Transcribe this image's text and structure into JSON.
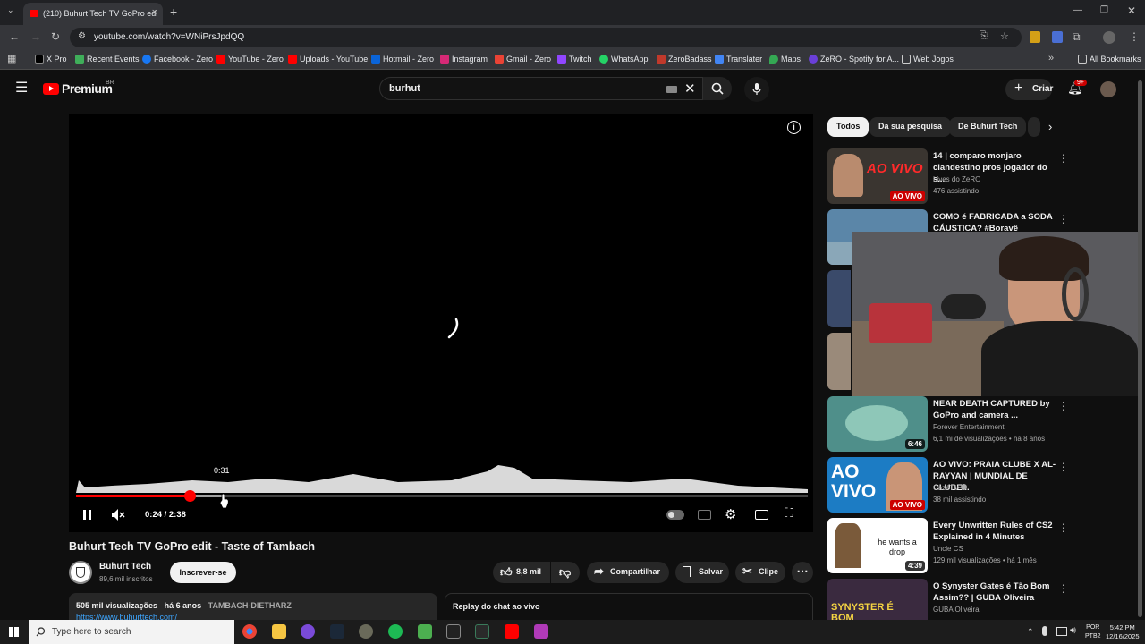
{
  "browser": {
    "tab_title": "(210) Buhurt Tech TV GoPro edi",
    "url": "youtube.com/watch?v=WNiPrsJpdQQ",
    "bookmarks": [
      "X Pro",
      "Recent Events",
      "Facebook - Zero",
      "YouTube - Zero",
      "Uploads - YouTube",
      "Hotmail - Zero",
      "Instagram",
      "Gmail - Zero",
      "Twitch",
      "WhatsApp",
      "ZeroBadass",
      "Translater",
      "Maps",
      "ZeRO - Spotify for A...",
      "Web Jogos"
    ],
    "all_bookmarks": "All Bookmarks"
  },
  "youtube": {
    "logo": "Premium",
    "logo_region": "BR",
    "search_value": "burhut",
    "create_label": "Criar",
    "notif_badge": "9+"
  },
  "player": {
    "hover_time": "0:31",
    "time_display": "0:24 / 2:38",
    "progress_fraction": 0.155,
    "buffer_fraction": 0.2
  },
  "video": {
    "title": "Buhurt Tech TV GoPro edit - Taste of Tambach",
    "channel": "Buhurt Tech",
    "subscribers": "89,6 mil inscritos",
    "subscribe_label": "Inscrever-se",
    "likes": "8,8 mil",
    "share_label": "Compartilhar",
    "save_label": "Salvar",
    "clip_label": "Clipe",
    "views": "505 mil visualizações",
    "age": "há 6 anos",
    "tags": "TAMBACH-DIETHARZ",
    "link": "https://www.buhurttech.com/",
    "chat_replay": "Replay do chat ao vivo"
  },
  "chips": [
    "Todos",
    "Da sua pesquisa",
    "De Buhurt Tech"
  ],
  "recommendations": [
    {
      "title": "14 | comparo monjaro clandestino pros jogador do s...",
      "channel": "Lives do ZeRO",
      "meta": "476 assistindo",
      "badge": "AO VIVO",
      "thumb_text": "AO VIVO",
      "thumb_color": "#3a3530"
    },
    {
      "title": "COMO é FABRICADA a SODA CÁUSTICA? #Boravê",
      "channel": "",
      "meta": "",
      "badge": "",
      "thumb_text": "",
      "thumb_color": "#5b86a8"
    },
    {
      "title": "NEAR DEATH CAPTURED by GoPro and camera ...",
      "channel": "Forever Entertainment",
      "meta": "6,1 mi de visualizações • há 8 anos",
      "badge": "6:46",
      "thumb_text": "",
      "thumb_color": "#4f8f8a"
    },
    {
      "title": "AO VIVO: PRAIA CLUBE X AL-RAYYAN | MUNDIAL DE CLUBE...",
      "channel": "CazéTV",
      "meta": "38 mil assistindo",
      "badge": "AO VIVO",
      "thumb_text": "AO VIVO",
      "thumb_color": "#1c7cc4"
    },
    {
      "title": "Every Unwritten Rules of CS2 Explained in 4 Minutes",
      "channel": "Uncle CS",
      "meta": "129 mil visualizações • há 1 mês",
      "badge": "4:39",
      "thumb_text": "he wants a drop",
      "thumb_color": "#ffffff"
    },
    {
      "title": "O Synyster Gates é Tão Bom Assim?? | GUBA Oliveira",
      "channel": "GUBA Oliveira",
      "meta": "",
      "badge": "",
      "thumb_text": "SYNYSTER É BOM",
      "thumb_color": "#3a2a3f"
    }
  ],
  "taskbar": {
    "search_placeholder": "Type here to search",
    "lang1": "POR",
    "lang2": "PTB2",
    "time": "5:42 PM",
    "date": "12/16/2025"
  }
}
